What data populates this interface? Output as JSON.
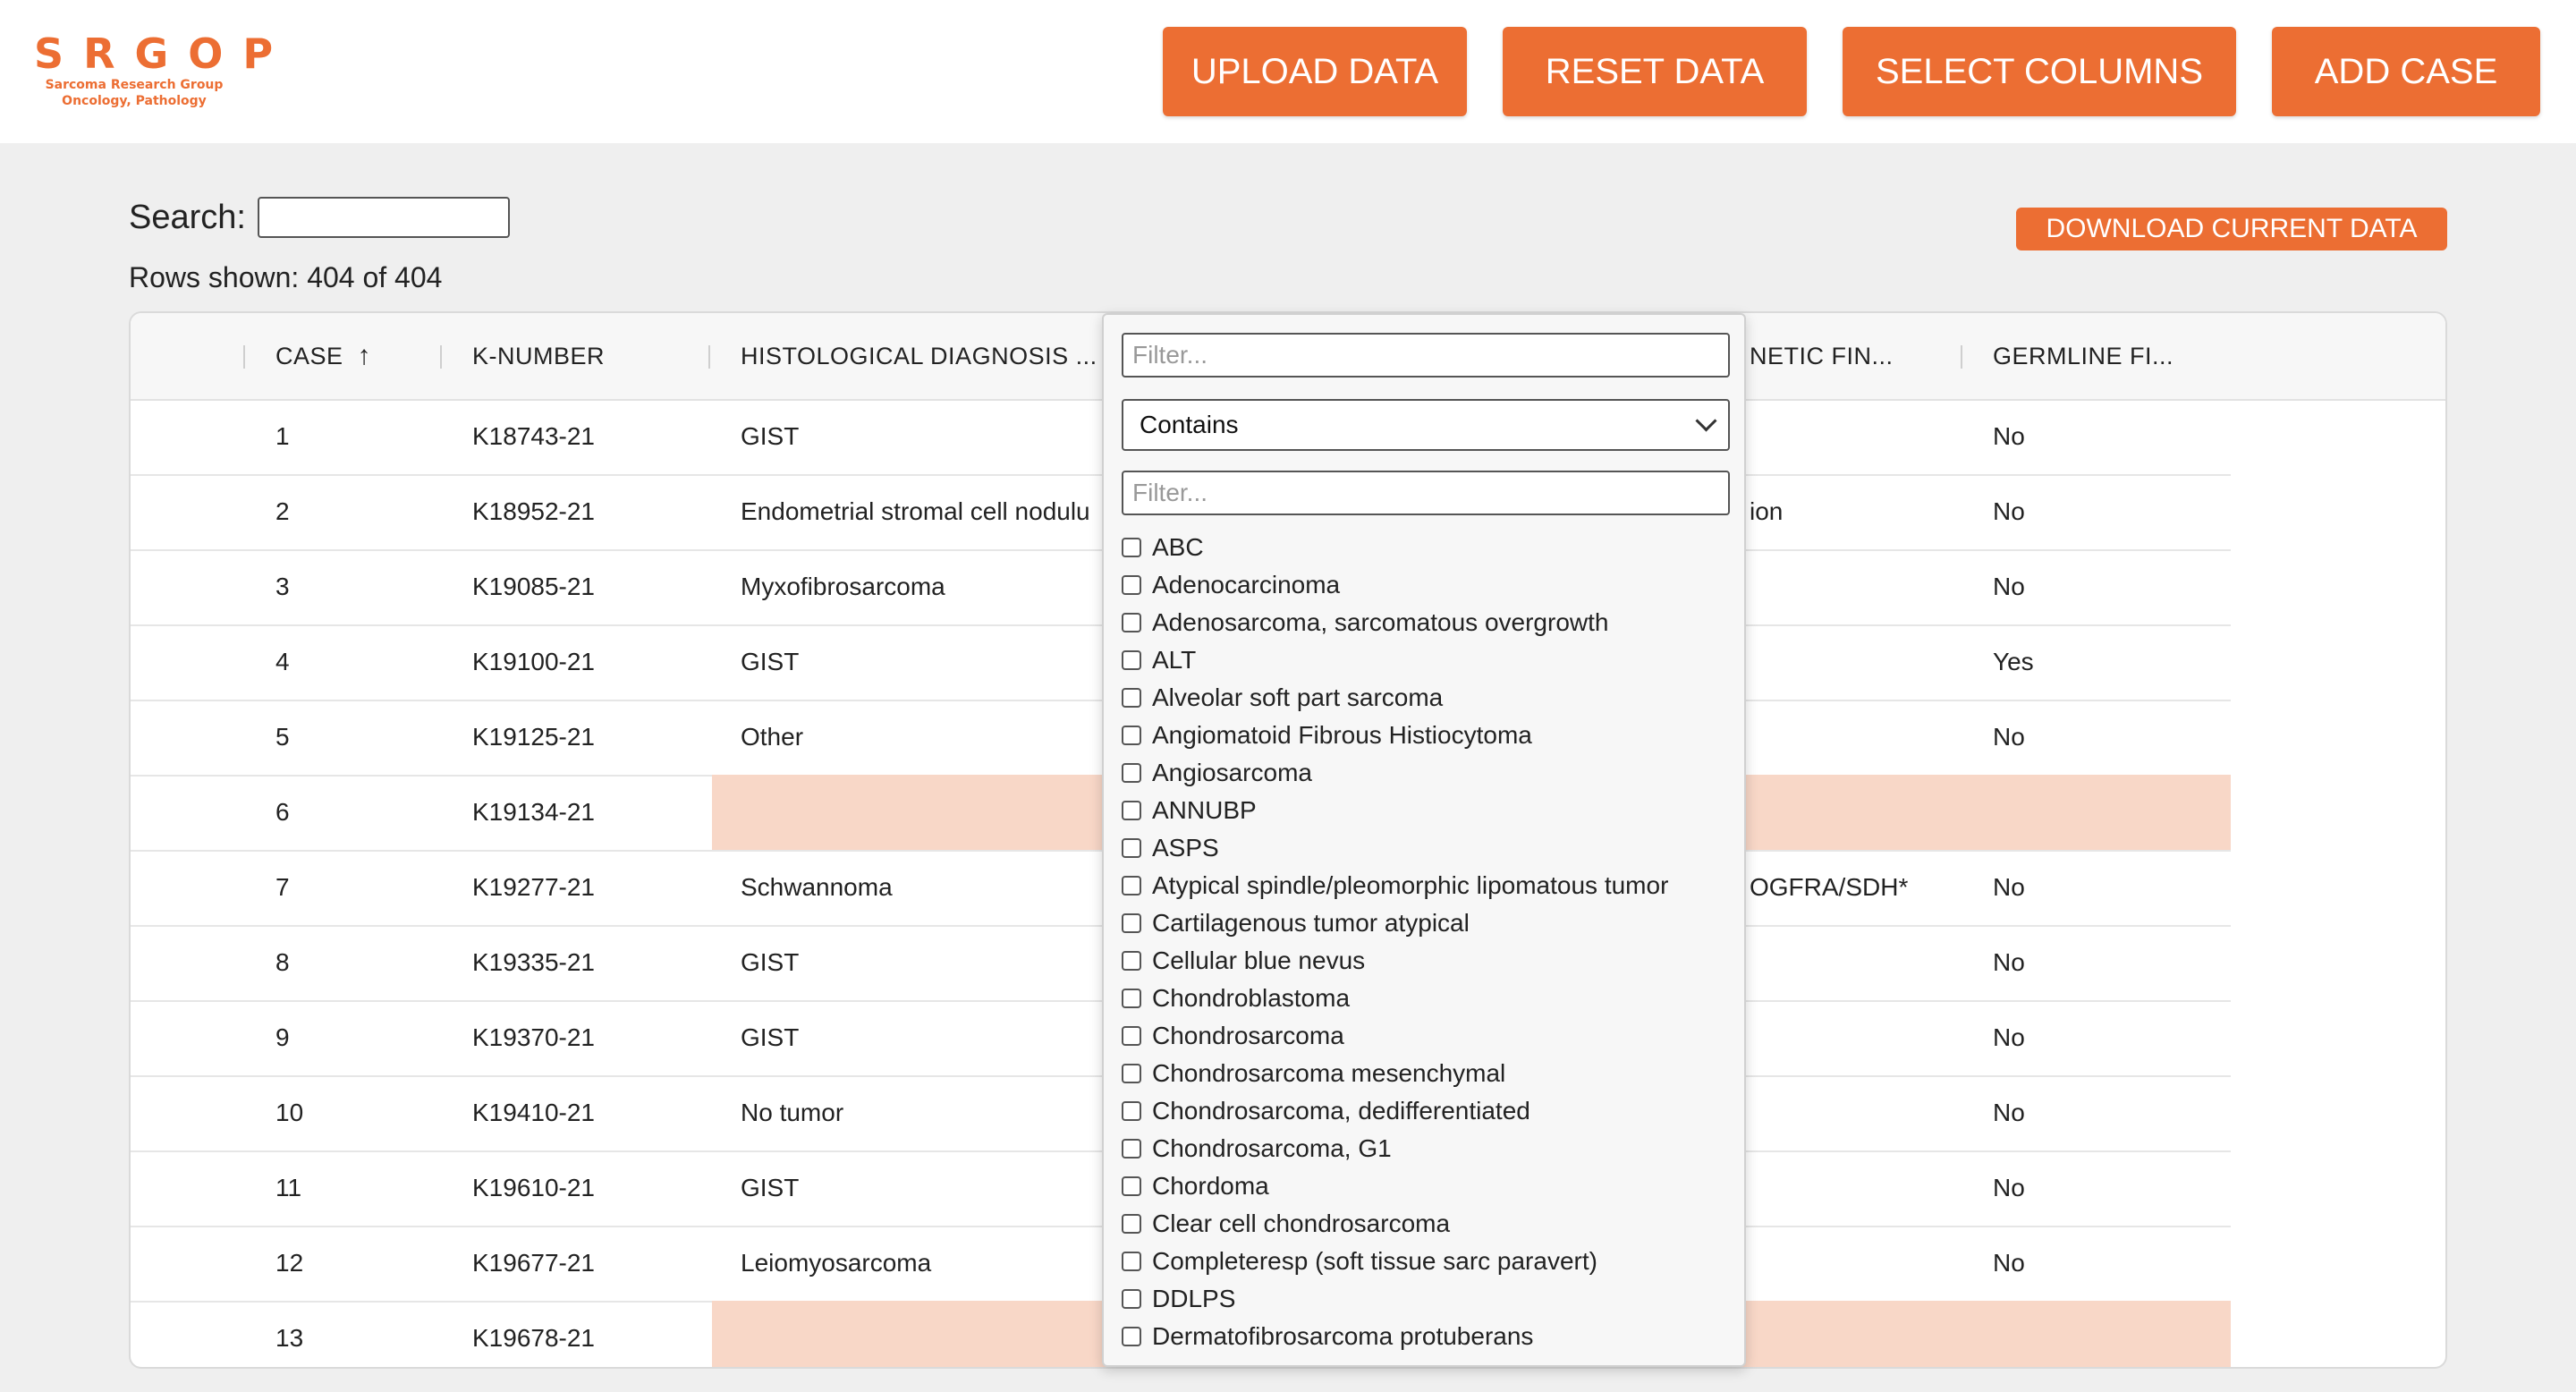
{
  "app": {
    "logo_text": "SRGOP",
    "logo_sub1": "Sarcoma Research Group",
    "logo_sub2": "Oncology, Pathology"
  },
  "header_buttons": {
    "upload": "UPLOAD DATA",
    "reset": "RESET DATA",
    "select_columns": "SELECT COLUMNS",
    "add_case": "ADD CASE"
  },
  "search": {
    "label": "Search:",
    "value": ""
  },
  "rows_shown": "Rows shown: 404 of 404",
  "download_label": "DOWNLOAD CURRENT DATA",
  "table": {
    "columns": [
      "CASE",
      "K-NUMBER",
      "HISTOLOGICAL DIAGNOSIS ...",
      "NETIC FIN...",
      "GERMLINE FI..."
    ],
    "sort_icon": "arrow-up-icon",
    "rows": [
      {
        "case": "1",
        "knum": "K18743-21",
        "diag": "GIST",
        "gen": "",
        "germ": "No",
        "highlight": false
      },
      {
        "case": "2",
        "knum": "K18952-21",
        "diag": "Endometrial stromal cell nodulu",
        "gen": "ion",
        "germ": "No",
        "highlight": false
      },
      {
        "case": "3",
        "knum": "K19085-21",
        "diag": "Myxofibrosarcoma",
        "gen": "",
        "germ": "No",
        "highlight": false
      },
      {
        "case": "4",
        "knum": "K19100-21",
        "diag": "GIST",
        "gen": "",
        "germ": "Yes",
        "highlight": false
      },
      {
        "case": "5",
        "knum": "K19125-21",
        "diag": "Other",
        "gen": "",
        "germ": "No",
        "highlight": false
      },
      {
        "case": "6",
        "knum": "K19134-21",
        "diag": "",
        "gen": "",
        "germ": "",
        "highlight": true
      },
      {
        "case": "7",
        "knum": "K19277-21",
        "diag": "Schwannoma",
        "gen": "OGFRA/SDH*",
        "germ": "No",
        "highlight": false
      },
      {
        "case": "8",
        "knum": "K19335-21",
        "diag": "GIST",
        "gen": "",
        "germ": "No",
        "highlight": false
      },
      {
        "case": "9",
        "knum": "K19370-21",
        "diag": "GIST",
        "gen": "",
        "germ": "No",
        "highlight": false
      },
      {
        "case": "10",
        "knum": "K19410-21",
        "diag": "No tumor",
        "gen": "",
        "germ": "No",
        "highlight": false
      },
      {
        "case": "11",
        "knum": "K19610-21",
        "diag": "GIST",
        "gen": "",
        "germ": "No",
        "highlight": false
      },
      {
        "case": "12",
        "knum": "K19677-21",
        "diag": "Leiomyosarcoma",
        "gen": "",
        "germ": "No",
        "highlight": false
      },
      {
        "case": "13",
        "knum": "K19678-21",
        "diag": "",
        "gen": "",
        "germ": "",
        "highlight": true
      }
    ],
    "highlight_color": "#f8d7c7"
  },
  "filter_popup": {
    "filter_placeholder": "Filter...",
    "operator": "Contains",
    "value_filter_placeholder": "Filter...",
    "options": [
      "ABC",
      "Adenocarcinoma",
      "Adenosarcoma, sarcomatous overgrowth",
      "ALT",
      "Alveolar soft part sarcoma",
      "Angiomatoid Fibrous Histiocytoma",
      "Angiosarcoma",
      "ANNUBP",
      "ASPS",
      "Atypical spindle/pleomorphic lipomatous tumor",
      "Cartilagenous tumor atypical",
      "Cellular blue nevus",
      "Chondroblastoma",
      "Chondrosarcoma",
      "Chondrosarcoma mesenchymal",
      "Chondrosarcoma, dedifferentiated",
      "Chondrosarcoma, G1",
      "Chordoma",
      "Clear cell chondrosarcoma",
      "Completeresp (soft tissue sarc paravert)",
      "DDLPS",
      "Dermatofibrosarcoma protuberans"
    ]
  },
  "colors": {
    "accent": "#ec6e33",
    "background": "#efefef"
  }
}
